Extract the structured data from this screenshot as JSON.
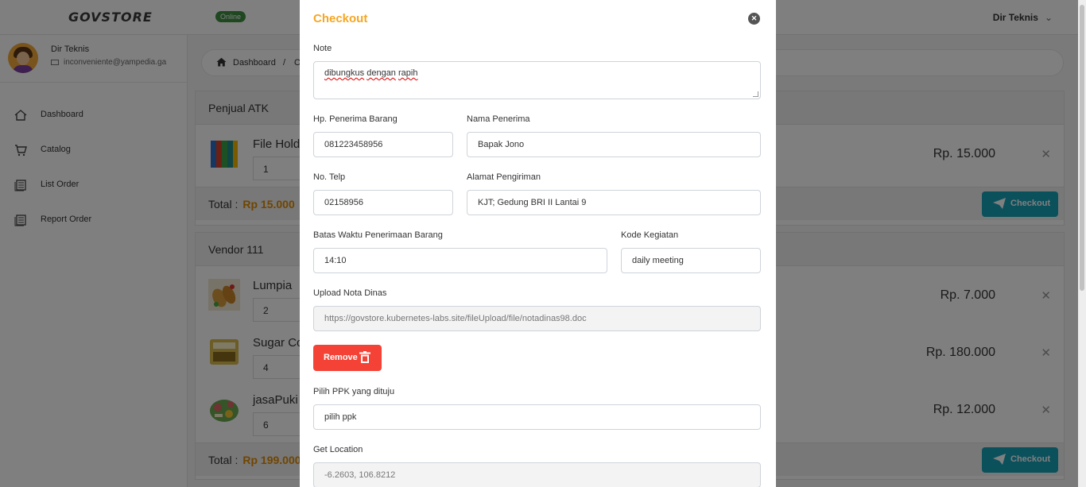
{
  "topbar": {
    "brand": "GOVSTORE",
    "status": "Online",
    "user_menu": "Dir Teknis"
  },
  "sidebar": {
    "profile_name": "Dir Teknis",
    "profile_email": "inconveniente@yampedia.ga",
    "items": [
      {
        "label": "Dashboard",
        "icon": "home-icon"
      },
      {
        "label": "Catalog",
        "icon": "cart-icon"
      },
      {
        "label": "List Order",
        "icon": "list-icon"
      },
      {
        "label": "Report Order",
        "icon": "report-icon"
      }
    ]
  },
  "breadcrumb": {
    "home": "Dashboard",
    "separator": "/",
    "current": "O"
  },
  "cart": {
    "groups": [
      {
        "vendor": "Penjual ATK",
        "items": [
          {
            "name": "File Hold",
            "qty": "1",
            "price": "Rp. 15.000"
          }
        ],
        "total_label": "Total :",
        "total_value": "Rp 15.000",
        "checkout_label": "Checkout"
      },
      {
        "vendor": "Vendor 111",
        "items": [
          {
            "name": "Lumpia",
            "qty": "2",
            "price": "Rp. 7.000"
          },
          {
            "name": "Sugar Co",
            "qty": "4",
            "price": "Rp. 180.000"
          },
          {
            "name": "jasaPuki",
            "qty": "6",
            "price": "Rp. 12.000"
          }
        ],
        "total_label": "Total :",
        "total_value": "Rp 199.000",
        "checkout_label": "Checkout"
      }
    ]
  },
  "modal": {
    "title": "Checkout",
    "note_label": "Note",
    "note_word_1": "dibungkus",
    "note_word_2": "dengan",
    "note_word_3": "rapih",
    "hp_label": "Hp. Penerima Barang",
    "hp_value": "081223458956",
    "nama_label": "Nama Penerima",
    "nama_value": "Bapak Jono",
    "telp_label": "No. Telp",
    "telp_value": "02158956",
    "alamat_label": "Alamat Pengiriman",
    "alamat_value": "KJT; Gedung BRI II Lantai 9",
    "batas_label": "Batas Waktu Penerimaan Barang",
    "batas_value": "14:10",
    "kode_label": "Kode Kegiatan",
    "kode_value": "daily meeting",
    "upload_label": "Upload Nota Dinas",
    "upload_value": "https://govstore.kubernetes-labs.site/fileUpload/file/notadinas98.doc",
    "remove_label": "Remove",
    "ppk_label": "Pilih PPK yang dituju",
    "ppk_value": "pilih ppk",
    "location_label": "Get Location",
    "location_value": "-6.2603, 106.8212"
  },
  "colors": {
    "accent_orange": "#f5a623",
    "checkout_teal": "#17a2b8",
    "remove_red": "#f44336",
    "online_green": "#3e8e41"
  }
}
